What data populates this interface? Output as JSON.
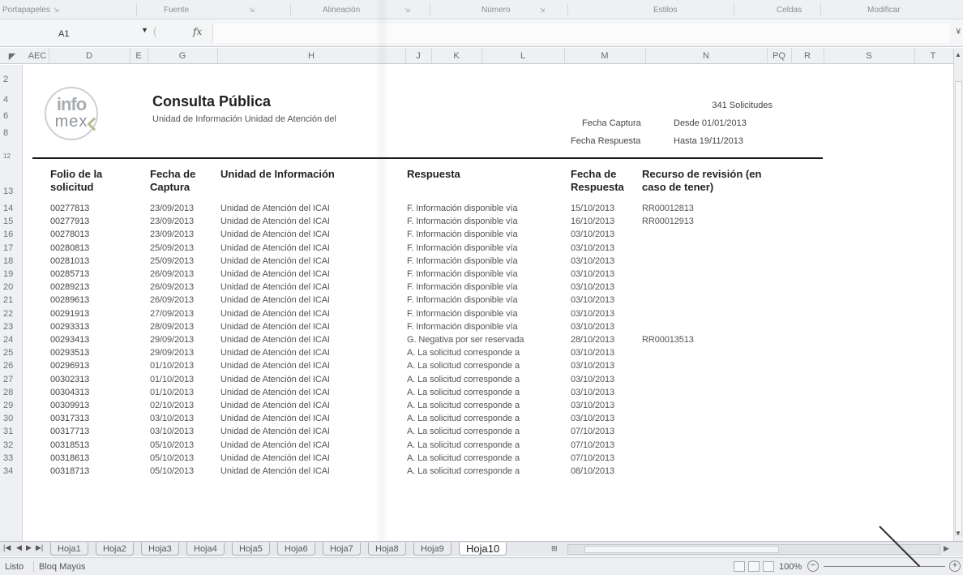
{
  "ribbon": {
    "groups": [
      "Portapapeles",
      "Fuente",
      "Alineación",
      "Número",
      "Estilos",
      "Celdas",
      "Modificar"
    ]
  },
  "formula_bar": {
    "name_box": "A1",
    "fx_label": "fx",
    "value": ""
  },
  "columns": [
    "AEC",
    "D",
    "E",
    "G",
    "H",
    "J",
    "K",
    "L",
    "M",
    "N",
    "PQ",
    "R",
    "S",
    "T"
  ],
  "report": {
    "logo_top": "info",
    "logo_bottom": "mex",
    "title": "Consulta Pública",
    "subtitle": "Unidad de Información   Unidad de Atención del",
    "count": "341 Solicitudes",
    "fecha_captura_label": "Fecha Captura",
    "fecha_captura_value": "Desde 01/01/2013",
    "fecha_respuesta_label": "Fecha Respuesta",
    "fecha_respuesta_value": "Hasta 19/11/2013"
  },
  "header_row_labels": [
    "2",
    "4",
    "6",
    "8",
    "12"
  ],
  "table": {
    "headers": {
      "folio": [
        "Folio de la",
        "solicitud"
      ],
      "fecha_captura": [
        "Fecha de",
        "Captura"
      ],
      "unidad": [
        "Unidad de Información"
      ],
      "respuesta": [
        "Respuesta"
      ],
      "fecha_respuesta": [
        "Fecha de",
        "Respuesta"
      ],
      "recurso": [
        "Recurso de revisión (en",
        "caso de tener)"
      ]
    },
    "header_row_number": "13",
    "rows": [
      {
        "n": "14",
        "folio": "00277813",
        "captura": "23/09/2013",
        "unidad": "Unidad de Atención del ICAI",
        "respuesta": "F. Información disponible vía",
        "fecha": "15/10/2013",
        "recurso": "RR00012813"
      },
      {
        "n": "15",
        "folio": "00277913",
        "captura": "23/09/2013",
        "unidad": "Unidad de Atención del ICAI",
        "respuesta": "F. Información disponible vía",
        "fecha": "16/10/2013",
        "recurso": "RR00012913"
      },
      {
        "n": "16",
        "folio": "00278013",
        "captura": "23/09/2013",
        "unidad": "Unidad de Atención del ICAI",
        "respuesta": "F. Información disponible vía",
        "fecha": "03/10/2013",
        "recurso": ""
      },
      {
        "n": "17",
        "folio": "00280813",
        "captura": "25/09/2013",
        "unidad": "Unidad de Atención del ICAI",
        "respuesta": "F. Información disponible vía",
        "fecha": "03/10/2013",
        "recurso": ""
      },
      {
        "n": "18",
        "folio": "00281013",
        "captura": "25/09/2013",
        "unidad": "Unidad de Atención del ICAI",
        "respuesta": "F. Información disponible vía",
        "fecha": "03/10/2013",
        "recurso": ""
      },
      {
        "n": "19",
        "folio": "00285713",
        "captura": "26/09/2013",
        "unidad": "Unidad de Atención del ICAI",
        "respuesta": "F. Información disponible vía",
        "fecha": "03/10/2013",
        "recurso": ""
      },
      {
        "n": "20",
        "folio": "00289213",
        "captura": "26/09/2013",
        "unidad": "Unidad de Atención del ICAI",
        "respuesta": "F. Información disponible vía",
        "fecha": "03/10/2013",
        "recurso": ""
      },
      {
        "n": "21",
        "folio": "00289613",
        "captura": "26/09/2013",
        "unidad": "Unidad de Atención del ICAI",
        "respuesta": "F. Información disponible vía",
        "fecha": "03/10/2013",
        "recurso": ""
      },
      {
        "n": "22",
        "folio": "00291913",
        "captura": "27/09/2013",
        "unidad": "Unidad de Atención del ICAI",
        "respuesta": "F. Información disponible vía",
        "fecha": "03/10/2013",
        "recurso": ""
      },
      {
        "n": "23",
        "folio": "00293313",
        "captura": "28/09/2013",
        "unidad": "Unidad de Atención del ICAI",
        "respuesta": "F. Información disponible vía",
        "fecha": "03/10/2013",
        "recurso": ""
      },
      {
        "n": "24",
        "folio": "00293413",
        "captura": "29/09/2013",
        "unidad": "Unidad de Atención del ICAI",
        "respuesta": "G. Negativa por ser reservada",
        "fecha": "28/10/2013",
        "recurso": "RR00013513"
      },
      {
        "n": "25",
        "folio": "00293513",
        "captura": "29/09/2013",
        "unidad": "Unidad de Atención del ICAI",
        "respuesta": "A. La solicitud corresponde a",
        "fecha": "03/10/2013",
        "recurso": ""
      },
      {
        "n": "26",
        "folio": "00296913",
        "captura": "01/10/2013",
        "unidad": "Unidad de Atención del ICAI",
        "respuesta": "A. La solicitud corresponde a",
        "fecha": "03/10/2013",
        "recurso": ""
      },
      {
        "n": "27",
        "folio": "00302313",
        "captura": "01/10/2013",
        "unidad": "Unidad de Atención del ICAI",
        "respuesta": "A. La solicitud corresponde a",
        "fecha": "03/10/2013",
        "recurso": ""
      },
      {
        "n": "28",
        "folio": "00304313",
        "captura": "01/10/2013",
        "unidad": "Unidad de Atención del ICAI",
        "respuesta": "A. La solicitud corresponde a",
        "fecha": "03/10/2013",
        "recurso": ""
      },
      {
        "n": "29",
        "folio": "00309913",
        "captura": "02/10/2013",
        "unidad": "Unidad de Atención del ICAI",
        "respuesta": "A. La solicitud corresponde a",
        "fecha": "03/10/2013",
        "recurso": ""
      },
      {
        "n": "30",
        "folio": "00317313",
        "captura": "03/10/2013",
        "unidad": "Unidad de Atención del ICAI",
        "respuesta": "A. La solicitud corresponde a",
        "fecha": "03/10/2013",
        "recurso": ""
      },
      {
        "n": "31",
        "folio": "00317713",
        "captura": "03/10/2013",
        "unidad": "Unidad de Atención del ICAI",
        "respuesta": "A. La solicitud corresponde a",
        "fecha": "07/10/2013",
        "recurso": ""
      },
      {
        "n": "32",
        "folio": "00318513",
        "captura": "05/10/2013",
        "unidad": "Unidad de Atención del ICAI",
        "respuesta": "A. La solicitud corresponde a",
        "fecha": "07/10/2013",
        "recurso": ""
      },
      {
        "n": "33",
        "folio": "00318613",
        "captura": "05/10/2013",
        "unidad": "Unidad de Atención del ICAI",
        "respuesta": "A. La solicitud corresponde a",
        "fecha": "07/10/2013",
        "recurso": ""
      },
      {
        "n": "34",
        "folio": "00318713",
        "captura": "05/10/2013",
        "unidad": "Unidad de Atención del ICAI",
        "respuesta": "A. La solicitud corresponde a",
        "fecha": "08/10/2013",
        "recurso": ""
      }
    ]
  },
  "sheet_tabs": [
    "Hoja1",
    "Hoja2",
    "Hoja3",
    "Hoja4",
    "Hoja5",
    "Hoja6",
    "Hoja7",
    "Hoja8",
    "Hoja9",
    "Hoja10"
  ],
  "active_sheet": "Hoja10",
  "status_bar": {
    "ready": "Listo",
    "caps": "Bloq Mayús",
    "zoom": "100%",
    "zoom_minus": "−",
    "zoom_plus": "+"
  }
}
